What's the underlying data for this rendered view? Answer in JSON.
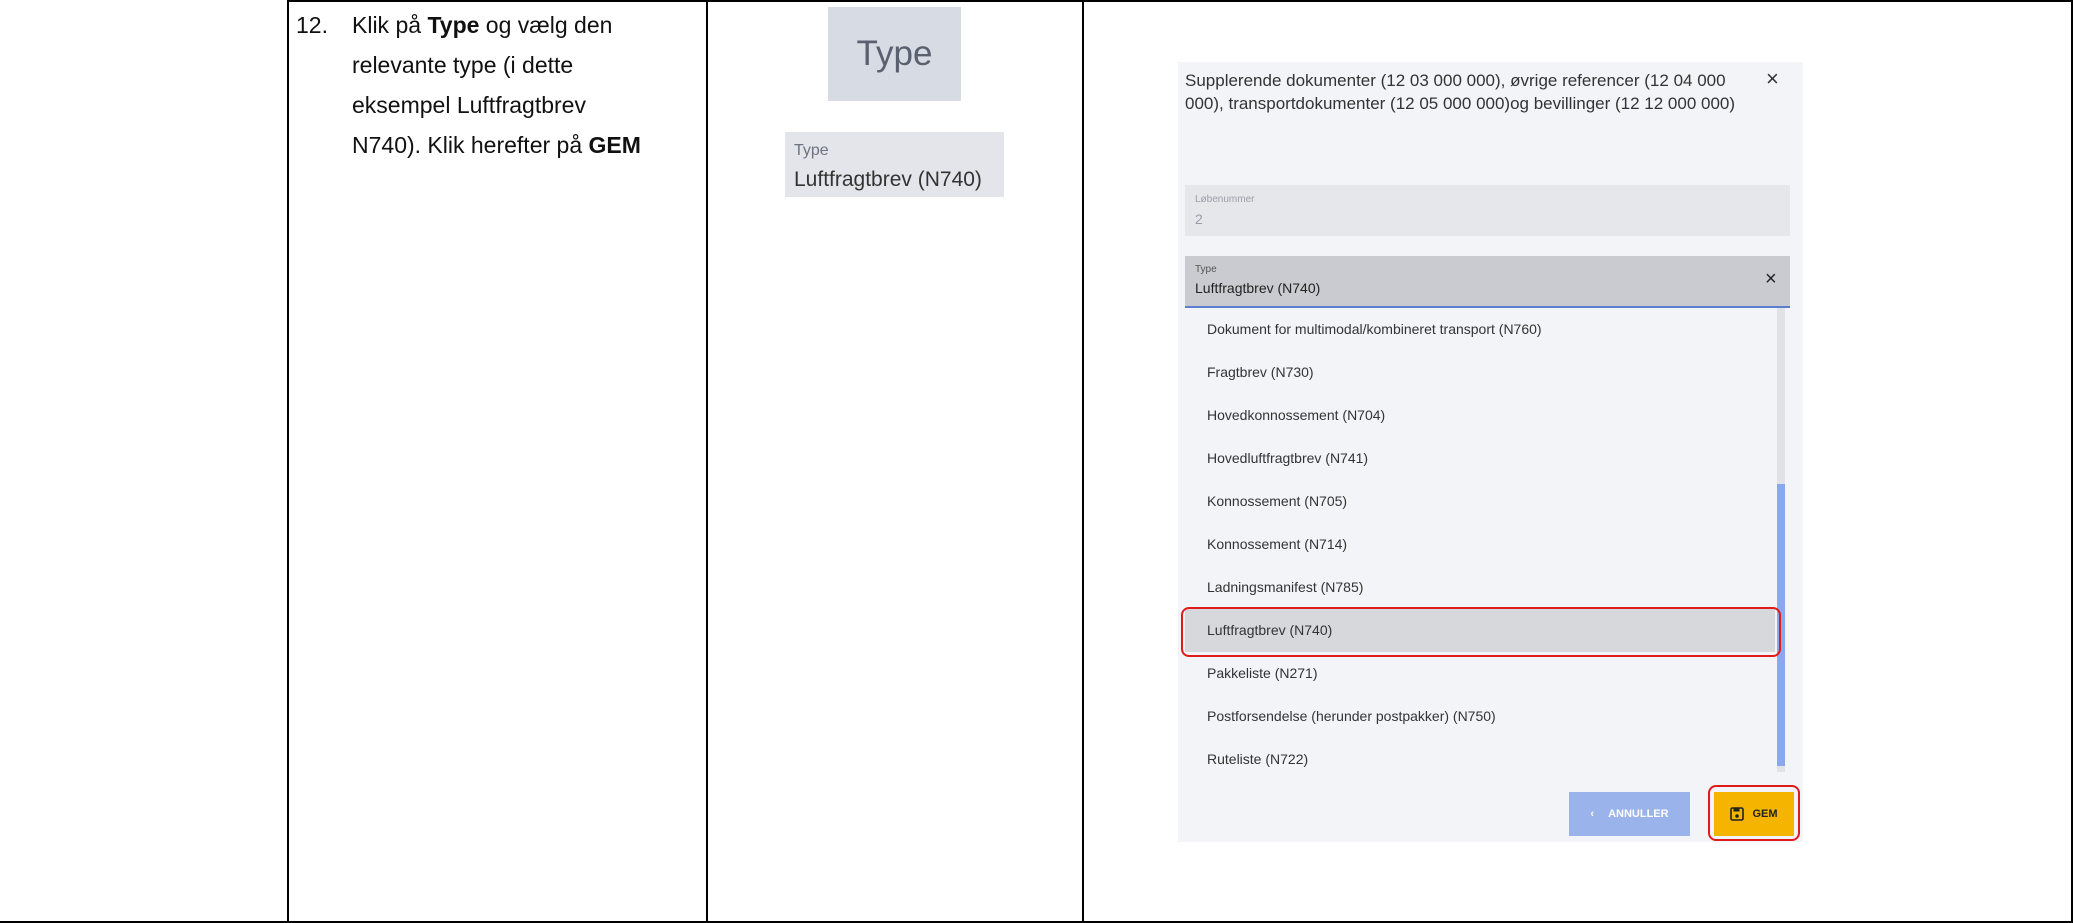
{
  "step": {
    "number": "12.",
    "line1_a": "Klik på ",
    "line1_bold": "Type",
    "line1_b": " og vælg den",
    "line2": "relevante type (i dette",
    "line3": "eksempel Luftfragtbrev",
    "line4_a": "N740). Klik herefter på ",
    "line4_bold": "GEM"
  },
  "snippets": {
    "type_button_label": "Type",
    "field_label": "Type",
    "field_value": "Luftfragtbrev (N740)"
  },
  "dialog": {
    "title": "Supplerende dokumenter (12 03 000 000), øvrige referencer (12 04 000 000), transportdokumenter (12 05 000 000)og bevillinger (12 12 000 000)",
    "close_icon": "×",
    "sequence_label": "Løbenummer",
    "sequence_value": "2",
    "type_label": "Type",
    "type_value": "Luftfragtbrev (N740)",
    "clear_icon": "×",
    "options": [
      "Dokument for multimodal/kombineret transport (N760)",
      "Fragtbrev (N730)",
      "Hovedkonnossement (N704)",
      "Hovedluftfragtbrev (N741)",
      "Konnossement (N705)",
      "Konnossement (N714)",
      "Ladningsmanifest (N785)",
      "Luftfragtbrev (N740)",
      "Pakkeliste (N271)",
      "Postforsendelse (herunder postpakker) (N750)",
      "Ruteliste (N722)"
    ],
    "selected_option": "Luftfragtbrev (N740)",
    "cancel_label": "ANNULLER",
    "save_label": "GEM"
  },
  "colors": {
    "save_button": "#f4b400",
    "cancel_button": "#9ab3ea",
    "highlight": "#e11a1a",
    "scrollbar": "#8aa8ec"
  }
}
